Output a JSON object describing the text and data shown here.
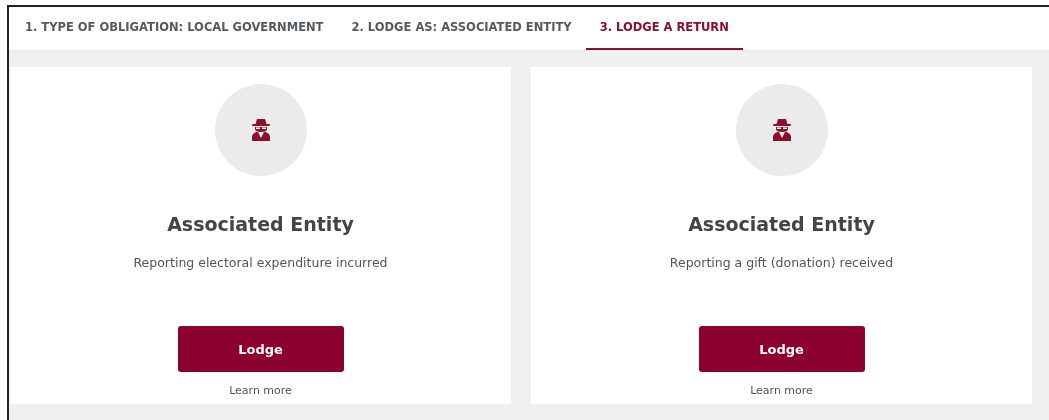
{
  "tabs": [
    {
      "label": "1. TYPE OF OBLIGATION: LOCAL GOVERNMENT",
      "selected": false
    },
    {
      "label": "2. LODGE AS: ASSOCIATED ENTITY",
      "selected": false
    },
    {
      "label": "3. LODGE A RETURN",
      "selected": true
    }
  ],
  "cards": [
    {
      "title": "Associated Entity",
      "description": "Reporting electoral expenditure incurred",
      "button": "Lodge",
      "link": "Learn more"
    },
    {
      "title": "Associated Entity",
      "description": "Reporting a gift (donation) received",
      "button": "Lodge",
      "link": "Learn more"
    }
  ]
}
